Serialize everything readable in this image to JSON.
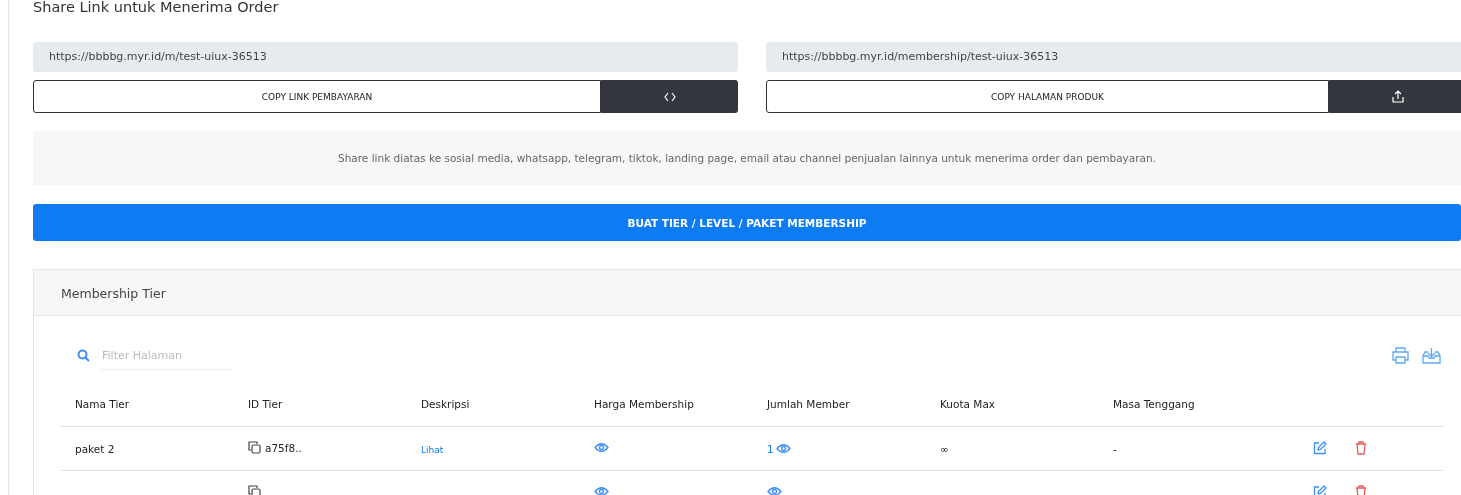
{
  "section_title": "Share Link untuk Menerima Order",
  "links": [
    {
      "url": "https://bbbbg.myr.id/m/test-uiux-36513",
      "copy_label": "COPY LINK PEMBAYARAN",
      "kind": "code"
    },
    {
      "url": "https://bbbbg.myr.id/membership/test-uiux-36513",
      "copy_label": "COPY HALAMAN PRODUK",
      "kind": "share"
    }
  ],
  "info": "Share link diatas ke sosial media, whatsapp, telegram, tiktok, landing page, email atau channel penjualan lainnya untuk menerima order dan pembayaran.",
  "create_button": "BUAT TIER / LEVEL / PAKET MEMBERSHIP",
  "card": {
    "title": "Membership Tier",
    "search": {
      "placeholder": "Filter Halaman"
    },
    "table": {
      "columns": [
        "Nama Tier",
        "ID Tier",
        "Deskripsi",
        "Harga Membership",
        "Jumlah Member",
        "Kuota Max",
        "Masa Tenggang"
      ],
      "rows": [
        {
          "name": "paket 2",
          "id": "a75f8..",
          "description": "Lihat",
          "members": "1",
          "quota": "∞",
          "grace": "-"
        },
        {}
      ]
    }
  }
}
